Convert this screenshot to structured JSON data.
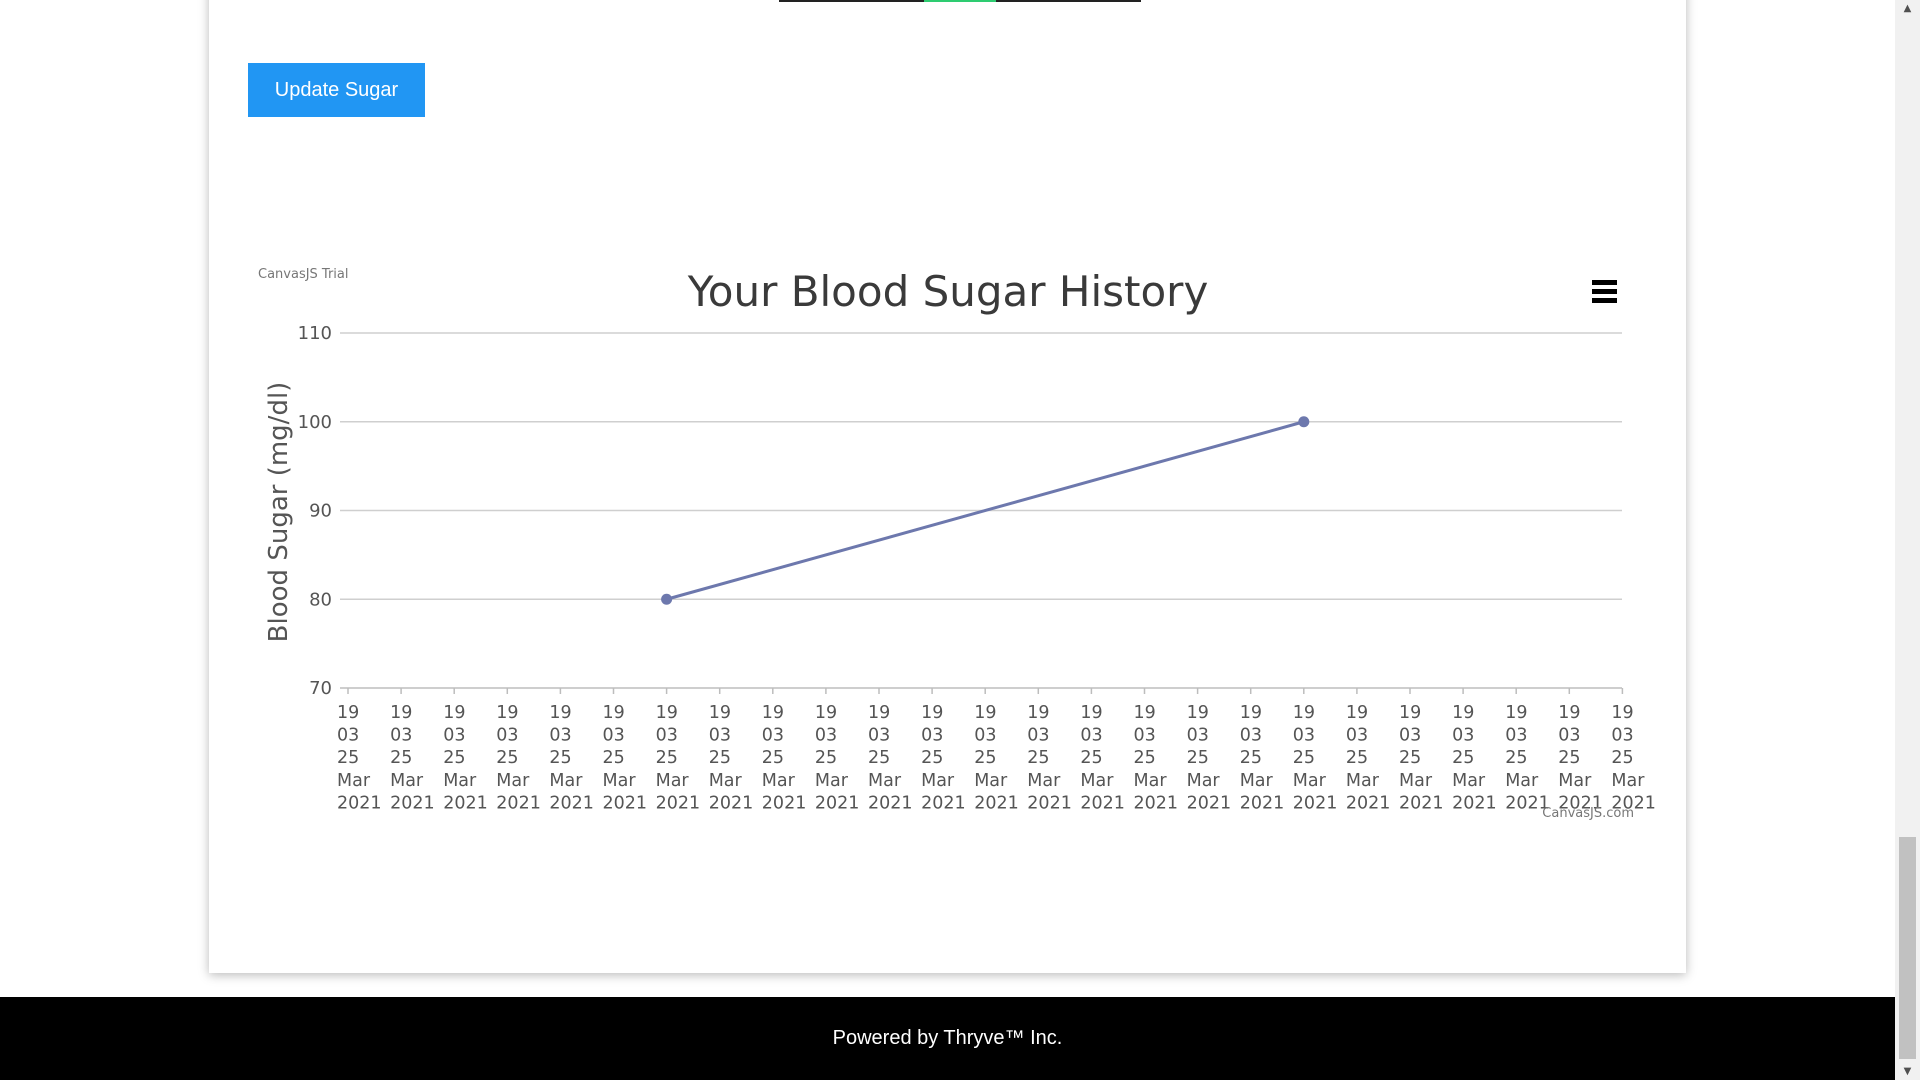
{
  "update_button": {
    "label": "Update Sugar"
  },
  "progress": {
    "value_fraction_start": 0.4,
    "value_fraction_end": 0.6,
    "color": "#2ecc71"
  },
  "chart_data": {
    "type": "line",
    "title": "Your Blood Sugar History",
    "xlabel": "",
    "ylabel": "Blood Sugar (mg/dl)",
    "ylim": [
      70,
      110
    ],
    "y_ticks": [
      70,
      80,
      90,
      100,
      110
    ],
    "grid": true,
    "x_ticks": [
      [
        "19",
        "03",
        "25",
        "Mar",
        "2021"
      ],
      [
        "19",
        "03",
        "25",
        "Mar",
        "2021"
      ],
      [
        "19",
        "03",
        "25",
        "Mar",
        "2021"
      ],
      [
        "19",
        "03",
        "25",
        "Mar",
        "2021"
      ],
      [
        "19",
        "03",
        "25",
        "Mar",
        "2021"
      ],
      [
        "19",
        "03",
        "25",
        "Mar",
        "2021"
      ],
      [
        "19",
        "03",
        "25",
        "Mar",
        "2021"
      ],
      [
        "19",
        "03",
        "25",
        "Mar",
        "2021"
      ],
      [
        "19",
        "03",
        "25",
        "Mar",
        "2021"
      ],
      [
        "19",
        "03",
        "25",
        "Mar",
        "2021"
      ],
      [
        "19",
        "03",
        "25",
        "Mar",
        "2021"
      ],
      [
        "19",
        "03",
        "25",
        "Mar",
        "2021"
      ],
      [
        "19",
        "03",
        "25",
        "Mar",
        "2021"
      ],
      [
        "19",
        "03",
        "25",
        "Mar",
        "2021"
      ],
      [
        "19",
        "03",
        "25",
        "Mar",
        "2021"
      ],
      [
        "19",
        "03",
        "25",
        "Mar",
        "2021"
      ],
      [
        "19",
        "03",
        "25",
        "Mar",
        "2021"
      ],
      [
        "19",
        "03",
        "25",
        "Mar",
        "2021"
      ],
      [
        "19",
        "03",
        "25",
        "Mar",
        "2021"
      ],
      [
        "19",
        "03",
        "25",
        "Mar",
        "2021"
      ],
      [
        "19",
        "03",
        "25",
        "Mar",
        "2021"
      ],
      [
        "19",
        "03",
        "25",
        "Mar",
        "2021"
      ],
      [
        "19",
        "03",
        "25",
        "Mar",
        "2021"
      ],
      [
        "19",
        "03",
        "25",
        "Mar",
        "2021"
      ],
      [
        "19",
        "03",
        "25",
        "Mar",
        "2021"
      ]
    ],
    "series": [
      {
        "points": [
          {
            "x_tick_index": 6,
            "y": 80
          },
          {
            "x_tick_index": 18,
            "y": 100
          }
        ],
        "color": "#6d78ad"
      }
    ],
    "credits": {
      "trial": "CanvasJS Trial",
      "site": "CanvasJS.com"
    },
    "menu_icon": "hamburger-icon"
  },
  "footer": {
    "text": "Powered by Thryve™ Inc."
  },
  "scrollbar": {
    "up_icon": "▲",
    "down_icon": "▼"
  }
}
